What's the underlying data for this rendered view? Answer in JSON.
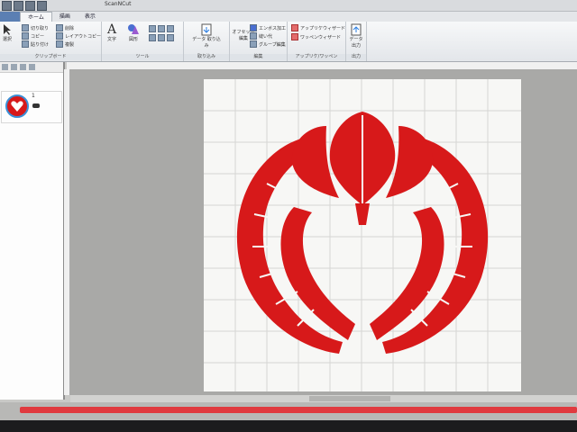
{
  "window": {
    "title": "ScanNCut"
  },
  "tabs": [
    {
      "label": "ホーム"
    },
    {
      "label": "描画"
    },
    {
      "label": "表示"
    }
  ],
  "ribbon": {
    "clipboard": {
      "label": "クリップボード",
      "select": "選択",
      "cut": "切り取り",
      "copy": "コピー",
      "paste": "貼り付け",
      "delete": "削除",
      "layout_copy": "レイアウトコピー",
      "duplicate": "複製"
    },
    "tools": {
      "label": "ツール",
      "text": "文字",
      "shape": "図形"
    },
    "import": {
      "label": "取り込み",
      "data_import": "データ 取り込み"
    },
    "edit": {
      "label": "編集",
      "offset": "オフセット 編集",
      "emboss": "エンボス加工",
      "seam": "縫い代",
      "group": "グループ編集"
    },
    "applique": {
      "label": "アップリケ/ワッペン",
      "applique_wizard": "アップリケウィザード",
      "patch_wizard": "ワッペンウィザード"
    },
    "output": {
      "label": "出力",
      "data_output": "データ 出力"
    }
  },
  "side_panel": {
    "items": [
      {
        "number": "1"
      }
    ]
  },
  "status": {
    "text": ""
  },
  "colors": {
    "accent_red": "#d7191a",
    "ribbon_bg": "#e8eaee"
  }
}
